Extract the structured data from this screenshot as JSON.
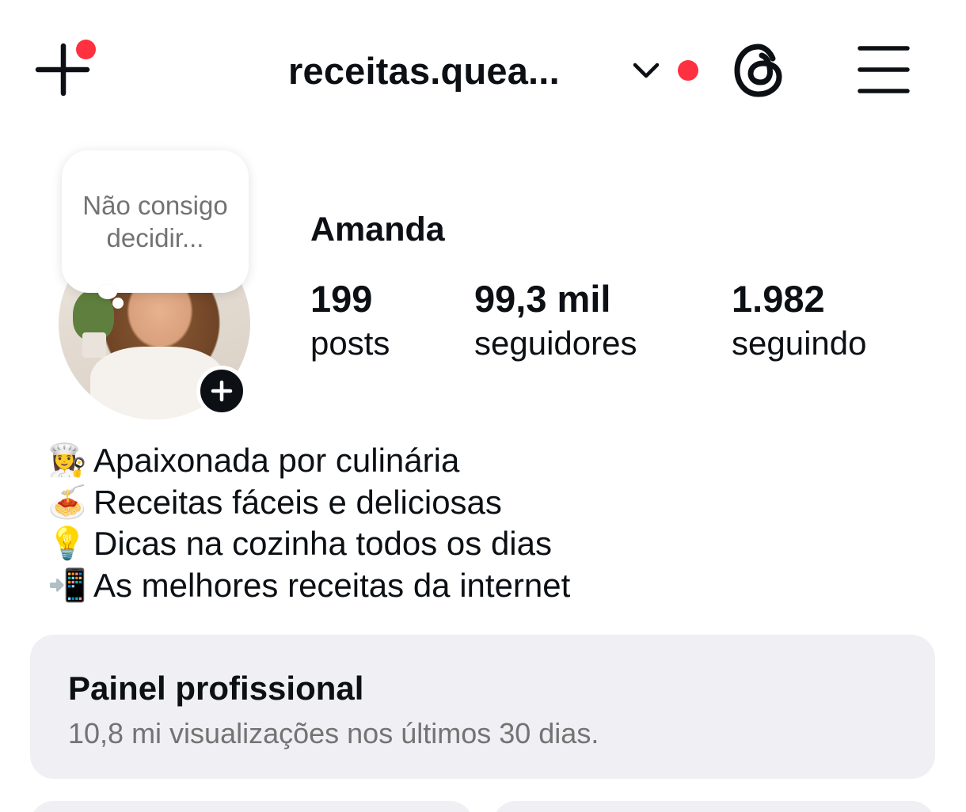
{
  "header": {
    "create_icon": "plus-icon",
    "username": "receitas.quea...",
    "chevron_icon": "chevron-down-icon",
    "threads_icon": "threads-icon",
    "menu_icon": "hamburger-menu-icon",
    "notification_color": "#ff3040"
  },
  "profile": {
    "note": "Não consigo decidir...",
    "add_story_icon": "plus-icon",
    "display_name": "Amanda",
    "stats": [
      {
        "value": "199",
        "label": "posts"
      },
      {
        "value": "99,3 mil",
        "label": "seguidores"
      },
      {
        "value": "1.982",
        "label": "seguindo"
      }
    ],
    "bio": [
      {
        "emoji": "👩‍🍳",
        "text": "Apaixonada por culinária"
      },
      {
        "emoji": "🍝",
        "text": "Receitas fáceis e deliciosas"
      },
      {
        "emoji": "💡",
        "text": "Dicas na cozinha todos os dias"
      },
      {
        "emoji": "📲",
        "text": "As melhores receitas da internet"
      }
    ]
  },
  "professional_panel": {
    "title": "Painel profissional",
    "subtitle": "10,8 mi visualizações nos últimos 30 dias."
  }
}
